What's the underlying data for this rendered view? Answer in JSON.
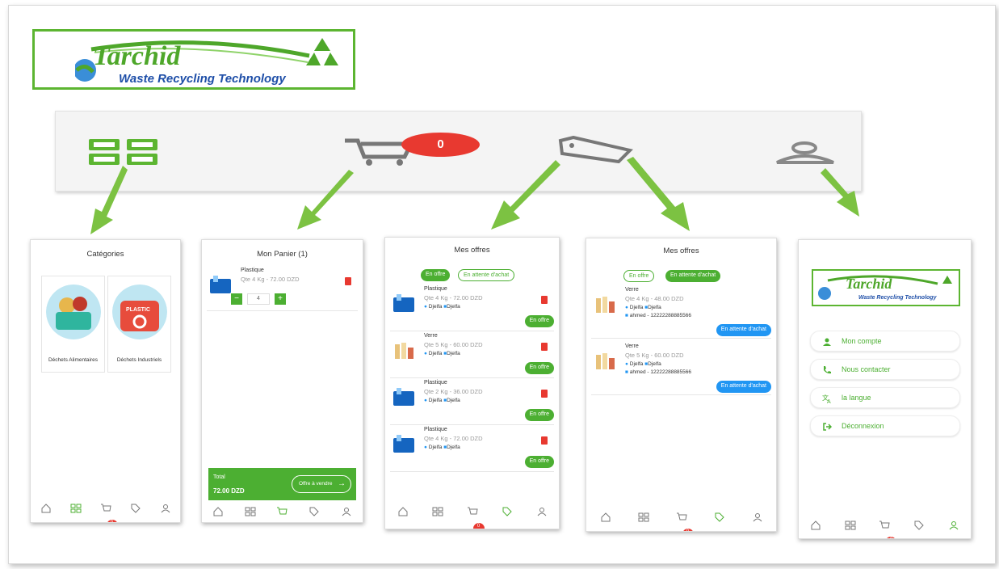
{
  "logo": {
    "brand": "Tarchid",
    "tagline": "Waste Recycling Technology"
  },
  "top_nav": {
    "cart_badge": "0",
    "icons": [
      "grid-icon",
      "cart-icon",
      "tag-icon",
      "user-icon"
    ]
  },
  "categories_screen": {
    "title": "Catégories",
    "cards": [
      {
        "label": "Déchets Alimentaires",
        "icon": "food-waste-icon"
      },
      {
        "label": "Déchets Industriels",
        "badge_text": "PLASTIC",
        "icon": "plastic-icon"
      }
    ],
    "nav_badge": "0"
  },
  "cart_screen": {
    "title": "Mon Panier (1)",
    "item": {
      "name": "Plastique",
      "detail": "Qte 4 Kg - 72.00 DZD",
      "quantity": "4"
    },
    "minus": "−",
    "plus": "+",
    "total_label": "Total",
    "total_value": "72.00 DZD",
    "checkout_label": "Offre à vendre",
    "nav_badge": "1"
  },
  "offers_screen": {
    "title": "Mes offres",
    "tab_active": "En offre",
    "tab_inactive": "En attente d'achat",
    "items": [
      {
        "name": "Plastique",
        "detail": "Qte 4 Kg - 72.00 DZD",
        "loc1": "Djelfa",
        "loc2": "Djelfa",
        "status": "En offre"
      },
      {
        "name": "Verre",
        "detail": "Qte 5 Kg - 60.00 DZD",
        "loc1": "Djelfa",
        "loc2": "Djelfa",
        "status": "En offre"
      },
      {
        "name": "Plastique",
        "detail": "Qte 2 Kg - 36.00 DZD",
        "loc1": "Djelfa",
        "loc2": "Djelfa",
        "status": "En offre"
      },
      {
        "name": "Plastique",
        "detail": "Qte 4 Kg - 72.00 DZD",
        "loc1": "Djelfa",
        "loc2": "Djelfa",
        "status": "En offre"
      }
    ],
    "nav_badge": "0"
  },
  "pending_screen": {
    "title": "Mes offres",
    "tab_inactive": "En offre",
    "tab_active": "En attente d'achat",
    "items": [
      {
        "name": "Verre",
        "detail": "Qte 4 Kg - 48.00 DZD",
        "loc1": "Djelfa",
        "loc2": "Djelfa",
        "buyer": "ahmed - 12222288885566",
        "status": "En attente d'achat"
      },
      {
        "name": "Verre",
        "detail": "Qte 5 Kg - 60.00 DZD",
        "loc1": "Djelfa",
        "loc2": "Djelfa",
        "buyer": "ahmed - 12222288885566",
        "status": "En attente d'achat"
      }
    ],
    "nav_badge": "0"
  },
  "account_screen": {
    "menu": [
      {
        "label": "Mon compte",
        "icon": "person-icon"
      },
      {
        "label": "Nous contacter",
        "icon": "phone-icon"
      },
      {
        "label": "la langue",
        "icon": "translate-icon"
      },
      {
        "label": "Déconnexion",
        "icon": "logout-icon"
      }
    ],
    "nav_badge": "0"
  },
  "colors": {
    "green": "#4caf32",
    "red": "#e83930",
    "blue": "#2196f3",
    "arrow": "#7cc242"
  }
}
